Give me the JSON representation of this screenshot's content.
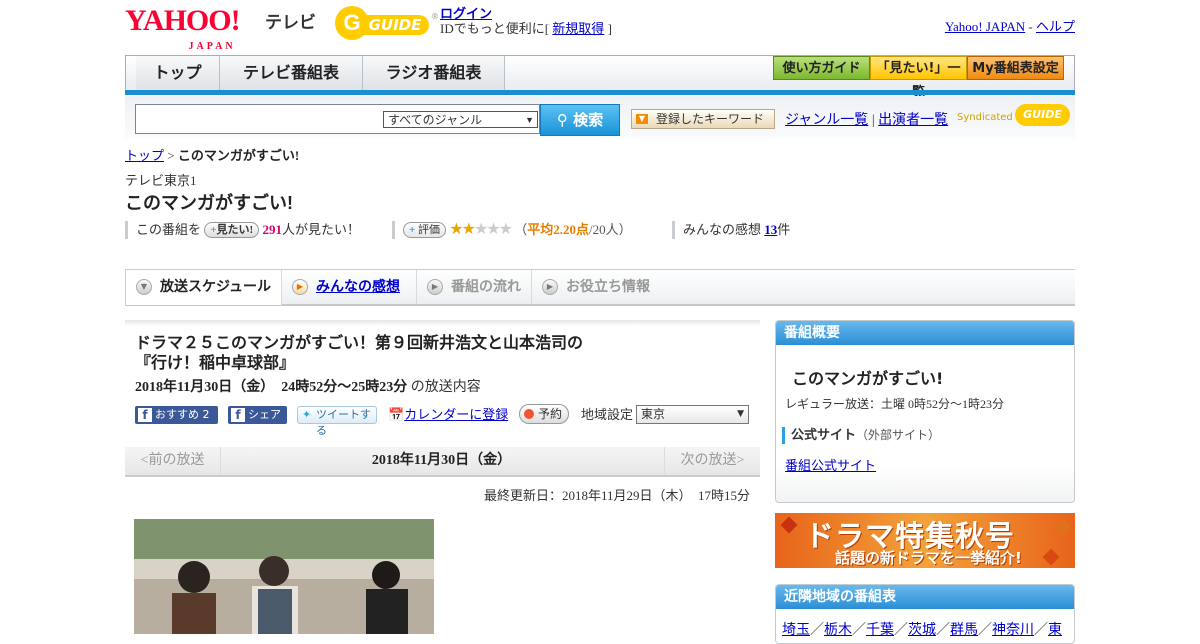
{
  "header": {
    "logo_text": "YAHOO!",
    "logo_sub": "JAPAN",
    "logo_tv": "テレビ",
    "gguide_g": "G",
    "gguide_text": "GUIDE",
    "gguide_reg": "®",
    "login": "ログイン",
    "id_text": "IDでもっと便利に[",
    "register": "新規取得",
    "id_close": "]",
    "yahoo_japan": "Yahoo! JAPAN",
    "sep": "-",
    "help": "ヘルプ"
  },
  "nav": {
    "tabs": [
      "トップ",
      "テレビ番組表",
      "ラジオ番組表"
    ],
    "right_buttons": [
      "使い方ガイド",
      "「見たい!」一覧",
      "My番組表設定"
    ],
    "right_colors": [
      "#8cc63f",
      "#ffd200",
      "#f7931e"
    ]
  },
  "search": {
    "placeholder": "",
    "genre_selected": "すべてのジャンル",
    "button": "検索",
    "keyword_button": "登録したキーワード",
    "genre_list": "ジャンル一覧",
    "divider": "|",
    "performer_list": "出演者一覧",
    "syndicated": "Syndicated",
    "synd_guide": "GUIDE"
  },
  "breadcrumb": {
    "top": "トップ",
    "sep": ">",
    "current": "このマンガがすごい!"
  },
  "program": {
    "station": "テレビ東京1",
    "title": "このマンガがすごい!",
    "mitai_prefix": "この番組を",
    "mitai_button": "見たい!",
    "mitai_count": "291",
    "mitai_suffix": "人が見たい！",
    "rating_label": "評価",
    "rating_stars": 2,
    "rating_avg_prefix": "（",
    "rating_avg": "平均2.20点",
    "rating_avg_suffix": "/20人）",
    "impressions_prefix": "みんなの感想",
    "impressions_count": "13",
    "impressions_suffix": "件"
  },
  "tabs": {
    "schedule": "放送スケジュール",
    "impressions": "みんなの感想",
    "flow": "番組の流れ",
    "info": "お役立ち情報"
  },
  "episode": {
    "title_line1": "ドラマ２５このマンガがすごい！第９回新井浩文と山本浩司の",
    "title_line2": "『行け！稲中卓球部』",
    "date_bold": "2018年11月30日（金）  24時52分～25時23分",
    "date_suffix": "の放送内容",
    "fb_recommend": "おすすめ",
    "fb_count": "2",
    "fb_share": "シェア",
    "tweet": "ツイートする",
    "calendar": "カレンダーに登録",
    "reserve": "予約",
    "region_label": "地域設定",
    "region_value": "東京",
    "prev": "<前の放送",
    "current_date": "2018年11月30日（金）",
    "next": "次の放送>",
    "updated": "最終更新日：2018年11月29日（木）　17時15分"
  },
  "sidebar": {
    "overview_title": "番組概要",
    "name": "このマンガがすごい!",
    "regular": "レギュラー放送：土曜 0時52分～1時23分",
    "official_label": "公式サイト",
    "official_note": "（外部サイト）",
    "official_link": "番組公式サイト",
    "banner_main": "ドラマ特集秋号",
    "banner_sub": "話題の新ドラマを一挙紹介!",
    "nearby_title": "近隣地域の番組表",
    "nearby_links": [
      "埼玉",
      "栃木",
      "千葉",
      "茨城",
      "群馬",
      "神奈川",
      "東"
    ],
    "nearby_sep": "／"
  }
}
